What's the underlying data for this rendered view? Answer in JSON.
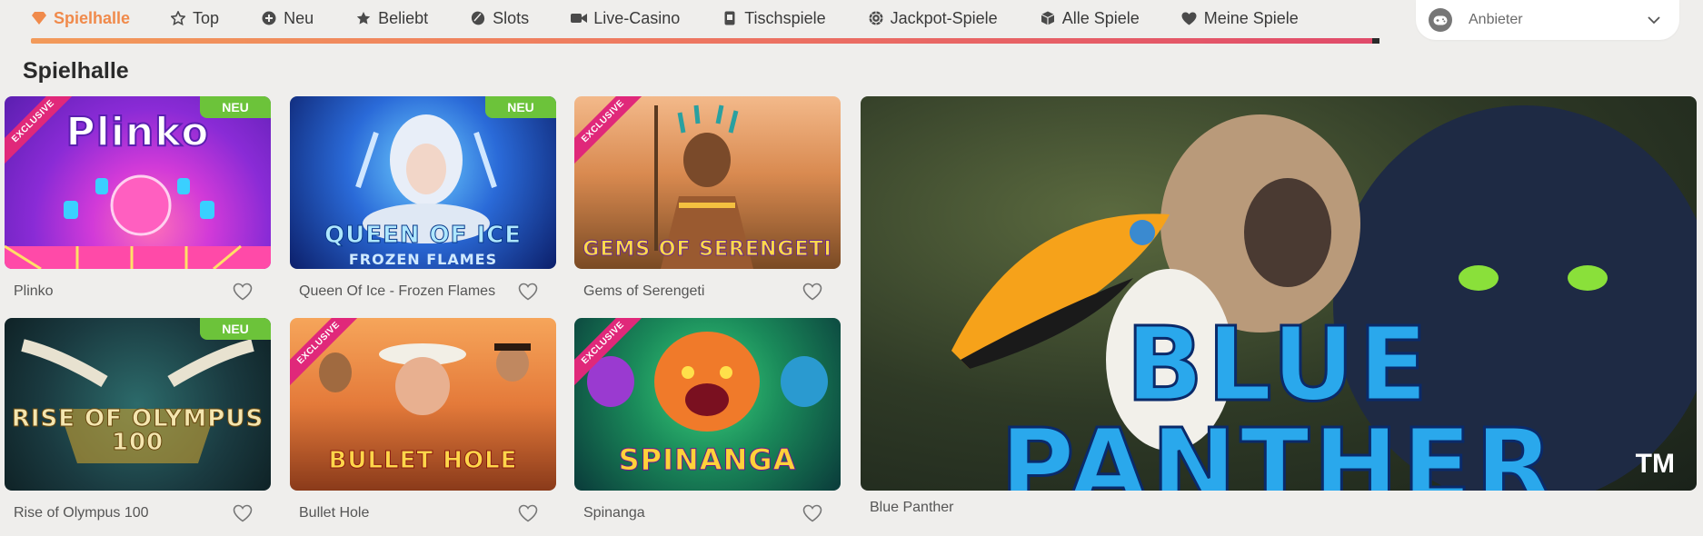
{
  "nav": {
    "items": [
      {
        "label": "Spielhalle",
        "icon": "gem-icon",
        "active": true
      },
      {
        "label": "Top",
        "icon": "star-outline-icon",
        "active": false
      },
      {
        "label": "Neu",
        "icon": "plus-circle-icon",
        "active": false
      },
      {
        "label": "Beliebt",
        "icon": "star-icon",
        "active": false
      },
      {
        "label": "Slots",
        "icon": "chip-icon",
        "active": false
      },
      {
        "label": "Live-Casino",
        "icon": "video-camera-icon",
        "active": false
      },
      {
        "label": "Tischspiele",
        "icon": "card-icon",
        "active": false
      },
      {
        "label": "Jackpot-Spiele",
        "icon": "roulette-icon",
        "active": false
      },
      {
        "label": "Alle Spiele",
        "icon": "cube-icon",
        "active": false
      },
      {
        "label": "Meine Spiele",
        "icon": "heart-icon",
        "active": false
      }
    ],
    "accent": "#f08a4b"
  },
  "provider": {
    "label": "Anbieter",
    "icon": "gamepad-icon"
  },
  "section": {
    "title": "Spielhalle"
  },
  "games": [
    {
      "name": "Plinko",
      "thumb_title": "Plinko",
      "badge": "NEU",
      "ribbon": "EXCLUSIVE"
    },
    {
      "name": "Queen Of Ice - Frozen Flames",
      "thumb_title": "QUEEN OF ICE",
      "thumb_sub": "FROZEN FLAMES",
      "badge": "NEU",
      "ribbon": ""
    },
    {
      "name": "Gems of Serengeti",
      "thumb_title": "GEMS OF SERENGETI",
      "badge": "",
      "ribbon": "EXCLUSIVE"
    },
    {
      "name": "Rise of Olympus 100",
      "thumb_title": "RISE OF OLYMPUS 100",
      "badge": "NEU",
      "ribbon": ""
    },
    {
      "name": "Bullet Hole",
      "thumb_title": "BULLET HOLE",
      "badge": "",
      "ribbon": "EXCLUSIVE"
    },
    {
      "name": "Spinanga",
      "thumb_title": "SPINANGA",
      "badge": "",
      "ribbon": "EXCLUSIVE"
    }
  ],
  "featured": {
    "name": "Blue Panther",
    "thumb_title": "BLUE PANTHER",
    "tm": "TM"
  }
}
